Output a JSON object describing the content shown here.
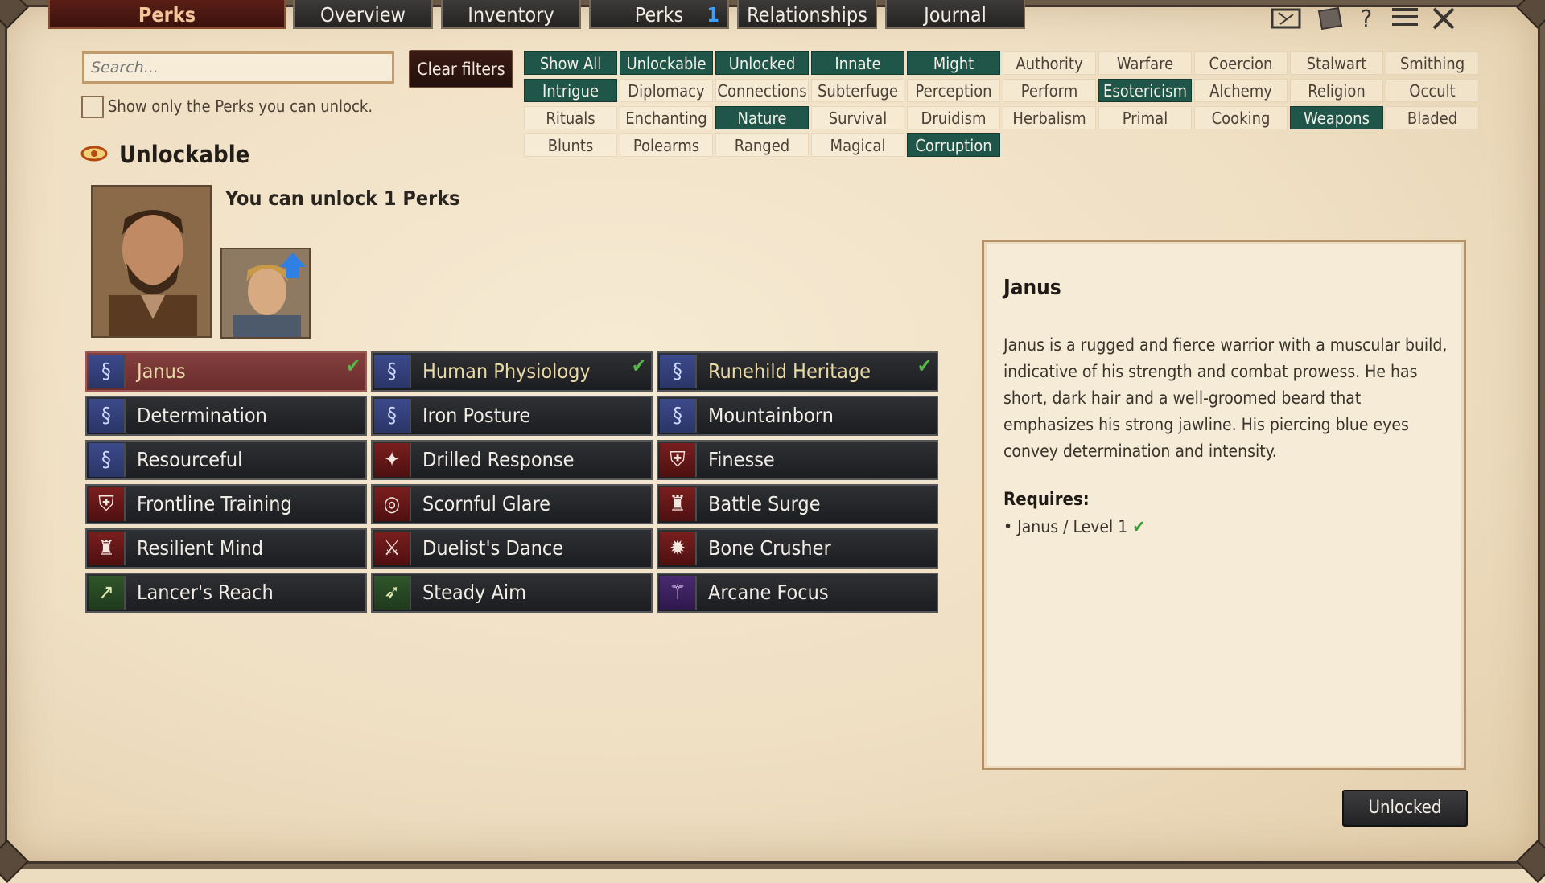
{
  "tabs": [
    {
      "label": "Perks",
      "active": true
    },
    {
      "label": "Overview",
      "active": false
    },
    {
      "label": "Inventory",
      "active": false
    },
    {
      "label": "Perks",
      "active": false,
      "badge": "1"
    },
    {
      "label": "Relationships",
      "active": false
    },
    {
      "label": "Journal",
      "active": false
    }
  ],
  "top_icons": [
    "map-icon",
    "scroll-icon",
    "help-icon",
    "menu-icon",
    "close-icon"
  ],
  "search": {
    "placeholder": "Search...",
    "clear_label": "Clear filters"
  },
  "only_unlockable": {
    "label": "Show only the Perks you can unlock.",
    "checked": false
  },
  "filters": {
    "row1": [
      {
        "label": "Show All",
        "on": true
      },
      {
        "label": "Unlockable",
        "on": true
      },
      {
        "label": "Unlocked",
        "on": true
      },
      {
        "label": "Innate",
        "on": true
      },
      {
        "label": "Might",
        "on": true
      },
      {
        "label": "Authority",
        "on": false
      },
      {
        "label": "Warfare",
        "on": false
      },
      {
        "label": "Coercion",
        "on": false
      },
      {
        "label": "Stalwart",
        "on": false
      },
      {
        "label": "Smithing",
        "on": false
      }
    ],
    "row2": [
      {
        "label": "Intrigue",
        "on": true
      },
      {
        "label": "Diplomacy",
        "on": false
      },
      {
        "label": "Connections",
        "on": false
      },
      {
        "label": "Subterfuge",
        "on": false
      },
      {
        "label": "Perception",
        "on": false
      },
      {
        "label": "Perform",
        "on": false
      },
      {
        "label": "Esotericism",
        "on": true
      },
      {
        "label": "Alchemy",
        "on": false
      },
      {
        "label": "Religion",
        "on": false
      },
      {
        "label": "Occult",
        "on": false
      }
    ],
    "row3": [
      {
        "label": "Rituals",
        "on": false
      },
      {
        "label": "Enchanting",
        "on": false
      },
      {
        "label": "Nature",
        "on": true
      },
      {
        "label": "Survival",
        "on": false
      },
      {
        "label": "Druidism",
        "on": false
      },
      {
        "label": "Herbalism",
        "on": false
      },
      {
        "label": "Primal",
        "on": false
      },
      {
        "label": "Cooking",
        "on": false
      },
      {
        "label": "Weapons",
        "on": true
      },
      {
        "label": "Bladed",
        "on": false
      }
    ],
    "row4": [
      {
        "label": "Blunts",
        "on": false
      },
      {
        "label": "Polearms",
        "on": false
      },
      {
        "label": "Ranged",
        "on": false
      },
      {
        "label": "Magical",
        "on": false
      },
      {
        "label": "Corruption",
        "on": true
      }
    ]
  },
  "section": {
    "title": "Unlockable",
    "unlock_text": "You can unlock 1 Perks"
  },
  "perks": [
    {
      "label": "Janus",
      "icon": "dna-icon",
      "color": "blue",
      "selected": true,
      "checked": true
    },
    {
      "label": "Human Physiology",
      "icon": "dna-icon",
      "color": "blue",
      "gold": true,
      "checked": true
    },
    {
      "label": "Runehild Heritage",
      "icon": "dna-icon",
      "color": "blue",
      "gold": true,
      "checked": true
    },
    {
      "label": "Determination",
      "icon": "dna-icon",
      "color": "blue"
    },
    {
      "label": "Iron Posture",
      "icon": "dna-icon",
      "color": "blue"
    },
    {
      "label": "Mountainborn",
      "icon": "dna-icon",
      "color": "blue"
    },
    {
      "label": "Resourceful",
      "icon": "dna-icon",
      "color": "blue"
    },
    {
      "label": "Drilled Response",
      "icon": "eagle-icon",
      "color": "red"
    },
    {
      "label": "Finesse",
      "icon": "helmet-icon",
      "color": "red"
    },
    {
      "label": "Frontline Training",
      "icon": "helmet-icon",
      "color": "red"
    },
    {
      "label": "Scornful Glare",
      "icon": "dragon-icon",
      "color": "red"
    },
    {
      "label": "Battle Surge",
      "icon": "strongman-icon",
      "color": "red"
    },
    {
      "label": "Resilient Mind",
      "icon": "strongman-icon",
      "color": "red"
    },
    {
      "label": "Duelist's Dance",
      "icon": "sword-icon",
      "color": "red"
    },
    {
      "label": "Bone Crusher",
      "icon": "mace-icon",
      "color": "red"
    },
    {
      "label": "Lancer's Reach",
      "icon": "spear-icon",
      "color": "green"
    },
    {
      "label": "Steady Aim",
      "icon": "bow-icon",
      "color": "green"
    },
    {
      "label": "Arcane Focus",
      "icon": "staff-icon",
      "color": "purple"
    }
  ],
  "detail": {
    "title": "Janus",
    "body": "Janus is a rugged and fierce warrior with a muscular build, indicative of his strength and combat prowess. He has short, dark hair and a well-groomed beard that emphasizes his strong jawline. His piercing blue eyes convey determination and intensity.",
    "requires_label": "Requires:",
    "requirement": "• Janus / Level 1",
    "requirement_met": true
  },
  "status_button": "Unlocked"
}
